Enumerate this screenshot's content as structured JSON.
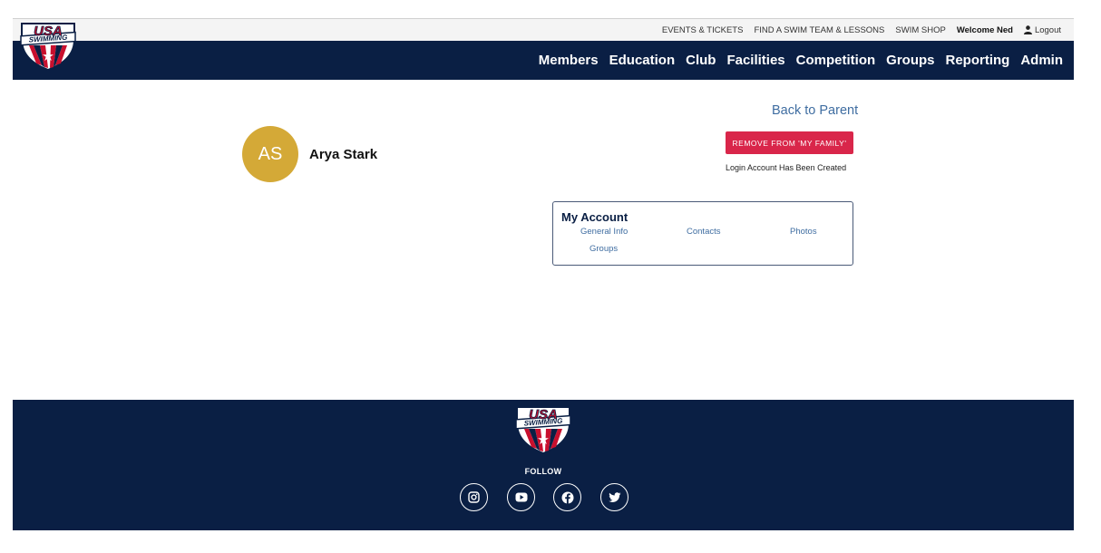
{
  "brand": {
    "logo_text_top": "USA",
    "logo_text_bottom": "SWIMMING",
    "colors": {
      "navy": "#0a1f44",
      "red": "#c8102e",
      "gold": "#d4a937",
      "link": "#3f6da1"
    }
  },
  "utility_nav": {
    "events": "EVENTS & TICKETS",
    "find_team": "FIND A SWIM TEAM & LESSONS",
    "shop": "SWIM SHOP",
    "welcome": "Welcome Ned",
    "logout": "Logout",
    "logout_icon": "user-icon"
  },
  "main_nav": {
    "items": [
      "Members",
      "Education",
      "Club",
      "Facilities",
      "Competition",
      "Groups",
      "Reporting",
      "Admin"
    ]
  },
  "member": {
    "initials": "AS",
    "name": "Arya Stark"
  },
  "actions": {
    "back": "Back to Parent",
    "remove": "REMOVE FROM 'MY FAMILY'",
    "status": "Login Account Has Been Created"
  },
  "account_card": {
    "title": "My Account",
    "links": [
      "General Info",
      "Contacts",
      "Photos",
      "Groups"
    ]
  },
  "footer": {
    "follow": "FOLLOW",
    "social": [
      "instagram-icon",
      "youtube-icon",
      "facebook-icon",
      "twitter-icon"
    ]
  }
}
